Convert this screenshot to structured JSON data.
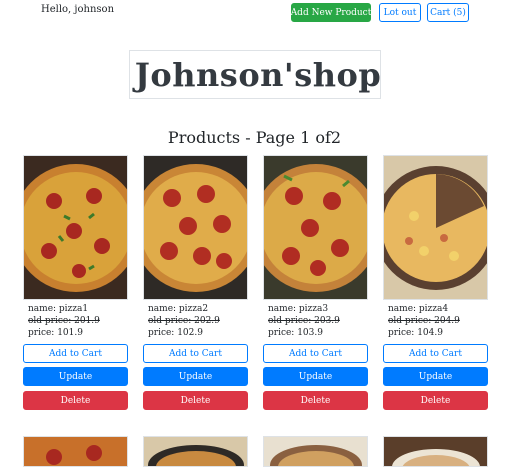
{
  "header": {
    "greeting": "Hello,  johnson",
    "add_product_label": "Add New Product",
    "logout_label": "Lot out",
    "cart_label": "Cart (5)"
  },
  "brand": {
    "shop_name": "Johnson'shop"
  },
  "page": {
    "heading": "Products - Page 1 of2"
  },
  "colors": {
    "success": "#28a745",
    "primary": "#007bff",
    "danger": "#dc3545"
  },
  "products": [
    {
      "name": "name: pizza1",
      "old_price": "old price: 201.9",
      "price": "price: 101.9",
      "add_label": "Add to Cart",
      "update_label": "Update",
      "delete_label": "Delete"
    },
    {
      "name": "name: pizza2",
      "old_price": "old price: 202.9",
      "price": "price: 102.9",
      "add_label": "Add to Cart",
      "update_label": "Update",
      "delete_label": "Delete"
    },
    {
      "name": "name: pizza3",
      "old_price": "old price: 203.9",
      "price": "price: 103.9",
      "add_label": "Add to Cart",
      "update_label": "Update",
      "delete_label": "Delete"
    },
    {
      "name": "name: pizza4",
      "old_price": "old price: 204.9",
      "price": "price: 104.9",
      "add_label": "Add to Cart",
      "update_label": "Update",
      "delete_label": "Delete"
    }
  ]
}
